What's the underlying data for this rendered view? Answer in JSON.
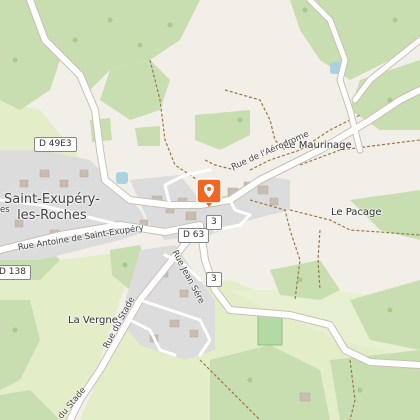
{
  "map": {
    "labels": {
      "town_line1": "Saint-Exupéry-",
      "town_line2": "les-Roches",
      "le_maurinage": "Le Maurinage",
      "le_pacage": "Le Pacage",
      "la_vergne": "La Vergne",
      "rue_aerodrome": "Rue de l'Aérodrome",
      "rue_antoine": "Rue Antoine de Saint-Exupéry",
      "rue_jean_sere": "Rue Jean Sére",
      "rue_du_stade_1": "Rue du Stade",
      "rue_du_stade_2": "du Stade",
      "es_fragment": "es"
    },
    "road_shields": {
      "d49e3": "D 49E3",
      "d63": "D 63",
      "d138": "D 138",
      "three_a": "3",
      "three_b": "3"
    },
    "marker": {
      "icon": "location-pin-icon",
      "color": "#f26522"
    },
    "colors": {
      "background": "#f2efe9",
      "forest": "#c8ddb0",
      "meadow": "#e3edc8",
      "residential": "#dcdcdc",
      "road": "#ffffff",
      "water": "#aad3df",
      "track": "#9a7a48"
    }
  }
}
